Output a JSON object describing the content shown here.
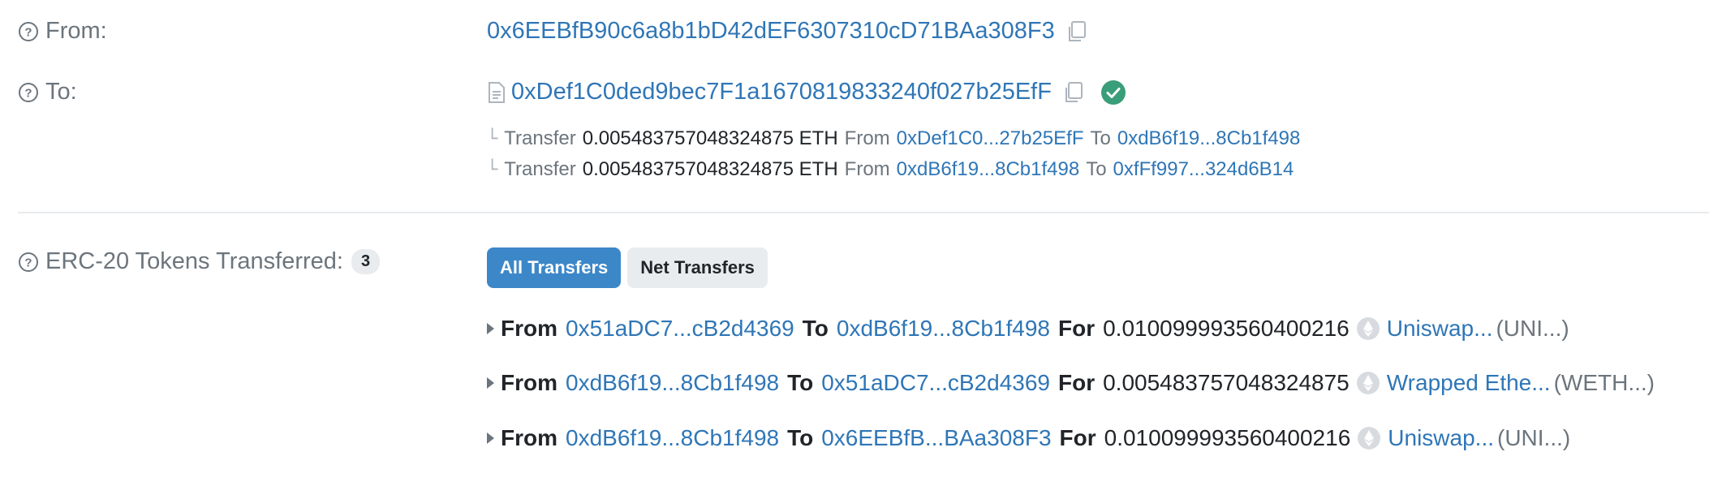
{
  "from": {
    "label": "From:",
    "address": "0x6EEBfB90c6a8b1bD42dEF6307310cD71BAa308F3"
  },
  "to": {
    "label": "To:",
    "address": "0xDef1C0ded9bec7F1a1670819833240f027b25EfF"
  },
  "internal_transfers": [
    {
      "kw": "Transfer",
      "amount": "0.005483757048324875 ETH",
      "from_kw": "From",
      "from": "0xDef1C0...27b25EfF",
      "to_kw": "To",
      "to": "0xdB6f19...8Cb1f498"
    },
    {
      "kw": "Transfer",
      "amount": "0.005483757048324875 ETH",
      "from_kw": "From",
      "from": "0xdB6f19...8Cb1f498",
      "to_kw": "To",
      "to": "0xfFf997...324d6B14"
    }
  ],
  "erc20": {
    "label": "ERC-20 Tokens Transferred:",
    "count": "3",
    "tabs": [
      "All Transfers",
      "Net Transfers"
    ],
    "transfers": [
      {
        "from_kw": "From",
        "from": "0x51aDC7...cB2d4369",
        "to_kw": "To",
        "to": "0xdB6f19...8Cb1f498",
        "for_kw": "For",
        "amount": "0.010099993560400216",
        "token": "Uniswap...",
        "symbol": "(UNI...)"
      },
      {
        "from_kw": "From",
        "from": "0xdB6f19...8Cb1f498",
        "to_kw": "To",
        "to": "0x51aDC7...cB2d4369",
        "for_kw": "For",
        "amount": "0.005483757048324875",
        "token": "Wrapped Ethe...",
        "symbol": "(WETH...)"
      },
      {
        "from_kw": "From",
        "from": "0xdB6f19...8Cb1f498",
        "to_kw": "To",
        "to": "0x6EEBfB...BAa308F3",
        "for_kw": "For",
        "amount": "0.010099993560400216",
        "token": "Uniswap...",
        "symbol": "(UNI...)"
      }
    ]
  },
  "colors": {
    "link": "#2f76b6",
    "accent": "#3c87c8",
    "success": "#3a9e78",
    "muted": "#6c757d"
  },
  "icons": {
    "help": "question-circle-icon",
    "copy": "copy-icon",
    "contract": "contract-file-icon",
    "verified": "check-circle-icon",
    "token": "eth-token-icon",
    "expand": "caret-right-icon"
  }
}
